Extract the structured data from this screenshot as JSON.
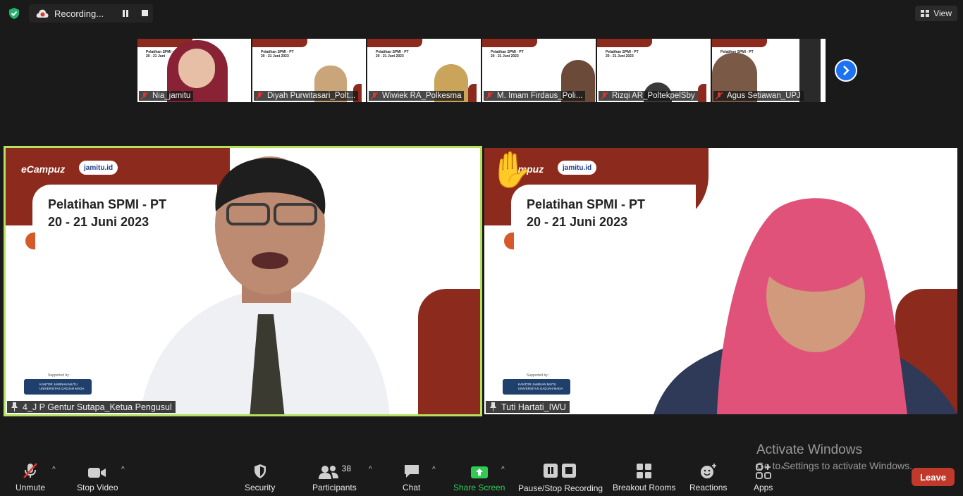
{
  "topbar": {
    "recording_label": "Recording...",
    "view_label": "View"
  },
  "thumbnails": [
    {
      "name": "Nia_jamitu",
      "slide_title": "Pelatihan SPMI - PT 20 - 21 Juni"
    },
    {
      "name": "Diyah Purwitasari_Polt...",
      "slide_title": "Pelatihan SPMI - PT 20 - 21 Juni 2023"
    },
    {
      "name": "Wiwiek RA_Polkesma",
      "slide_title": "Pelatihan SPMI - PT 20 - 21 Juni 2023"
    },
    {
      "name": "M. Imam Firdaus_Poli...",
      "slide_title": "Pelatihan SPMI - PT 20 - 21 Juni 2023"
    },
    {
      "name": "Rizqi AR_PoltekpelSby",
      "slide_title": "Pelatihan SPMI - PT 20 - 21 Juni 2023"
    },
    {
      "name": "Agus Setiawan_UPJ",
      "slide_title": "Pelatihan SPMI - PT"
    }
  ],
  "tiles": [
    {
      "name": "4_J P Gentur Sutapa_Ketua Pengusul",
      "brand": "eCampuz",
      "partner": "jamitu.id",
      "title_line1": "Pelatihan SPMI - PT",
      "title_line2": "20 - 21 Juni 2023",
      "supported": "Supported by :",
      "sponsor": "KANTOR JAMINAN MUTU UNIVERSITAS GADJAH MADA"
    },
    {
      "name": "Tuti Hartati_IWU",
      "brand": "eCampuz",
      "partner": "jamitu.id",
      "title_line1": "Pelatihan SPMI - PT",
      "title_line2": "20 - 21 Juni 2023",
      "supported": "Supported by :",
      "sponsor": "KANTOR JAMINAN MUTU UNIVERSITAS GADJAH MADA"
    }
  ],
  "watermark": {
    "line1": "Activate Windows",
    "line2": "Go to Settings to activate Windows."
  },
  "toolbar": {
    "unmute": "Unmute",
    "stop_video": "Stop Video",
    "security": "Security",
    "participants": "Participants",
    "participants_count": "38",
    "chat": "Chat",
    "share_screen": "Share Screen",
    "pause_stop_recording": "Pause/Stop Recording",
    "breakout_rooms": "Breakout Rooms",
    "reactions": "Reactions",
    "apps": "Apps",
    "leave": "Leave"
  },
  "colors": {
    "active_speaker_border": "#b6e15e",
    "slide_brand": "#8c2a1d",
    "share_green": "#2fcc55",
    "leave_red": "#c0392b",
    "next_arrow_blue": "#1d72f2"
  }
}
